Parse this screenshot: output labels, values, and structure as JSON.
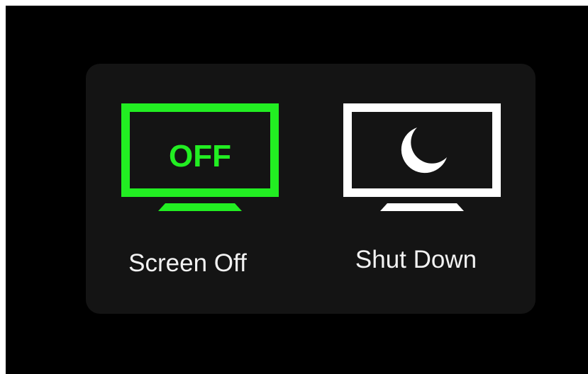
{
  "power_menu": {
    "options": [
      {
        "label": "Screen Off",
        "icon": "monitor-off-icon",
        "icon_text": "OFF",
        "color": "#22ee22",
        "selected": true
      },
      {
        "label": "Shut Down",
        "icon": "monitor-moon-icon",
        "color": "#ffffff",
        "selected": false
      }
    ]
  },
  "colors": {
    "background": "#000000",
    "panel": "#141414",
    "accent": "#22ee22",
    "text": "#f2f2f2"
  }
}
